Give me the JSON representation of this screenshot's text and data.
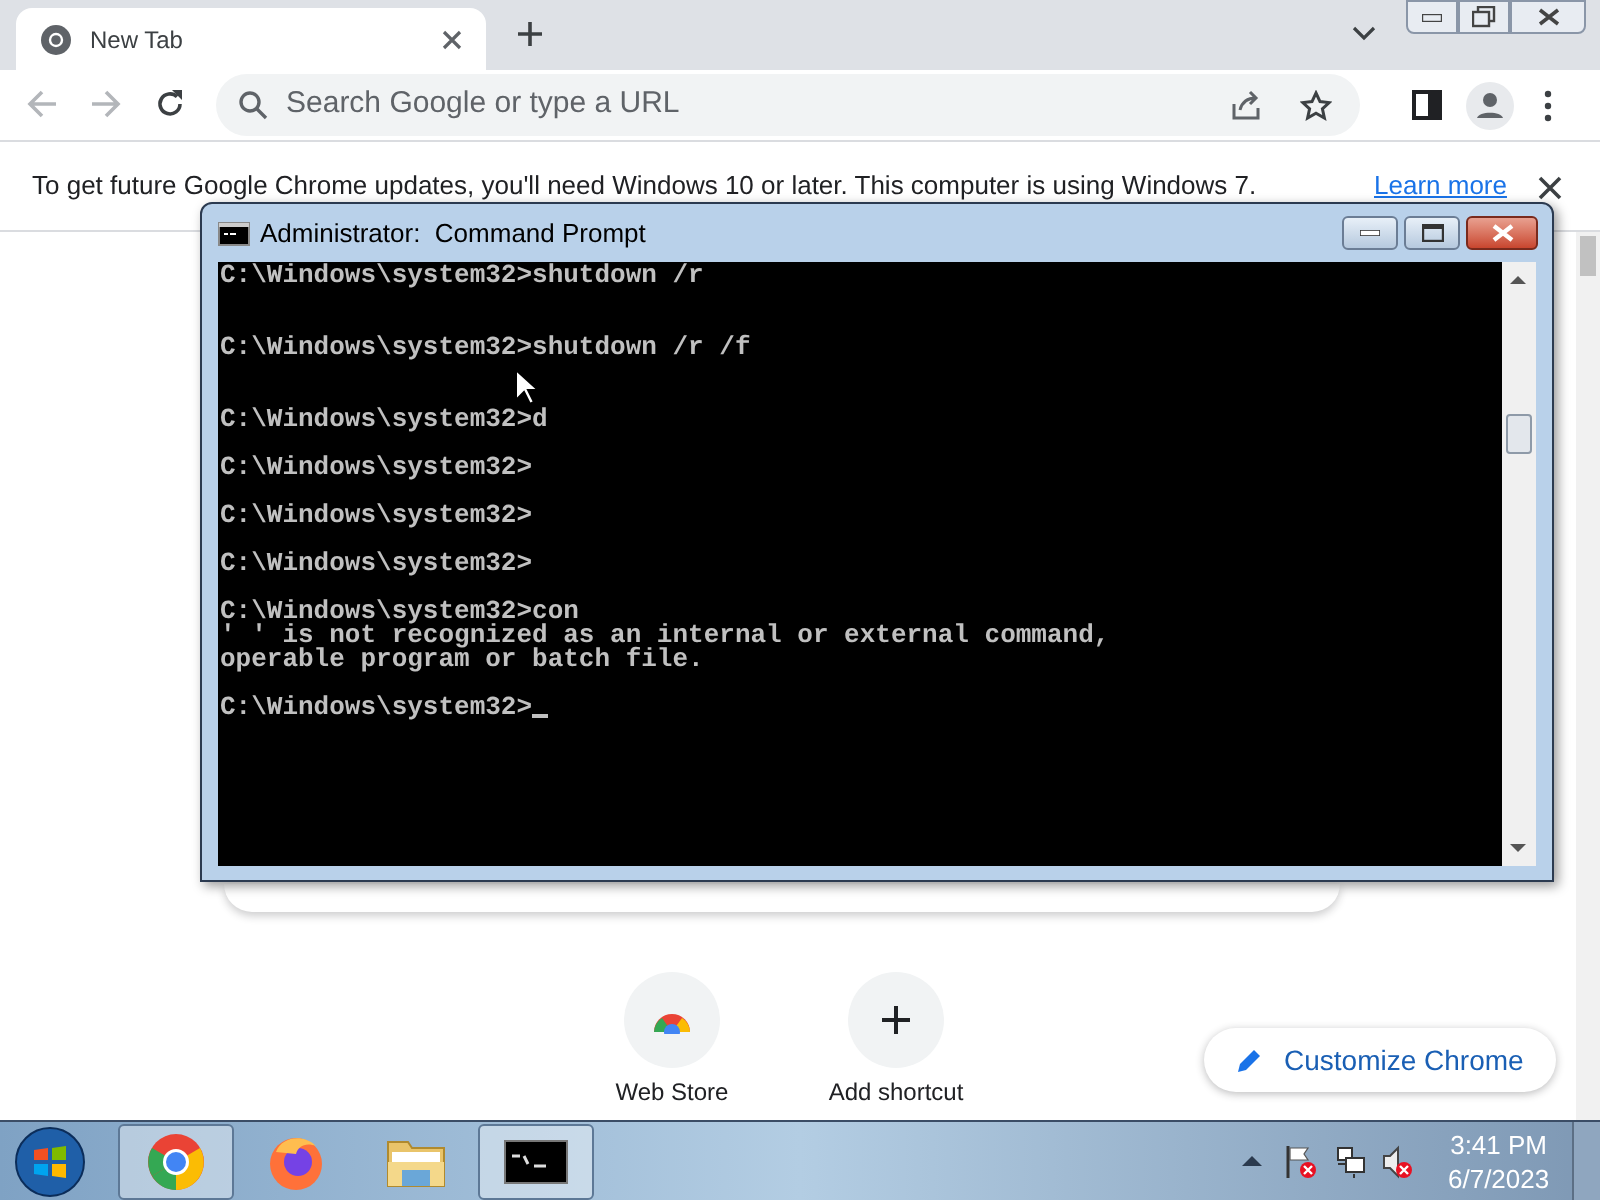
{
  "browser": {
    "tabs": [
      {
        "title": "New Tab",
        "selected": true
      }
    ],
    "omnibox": {
      "placeholder": "Search Google or type a URL"
    },
    "infobar": {
      "message": "To get future Google Chrome updates, you'll need Windows 10 or later. This computer is using Windows 7.",
      "link": "Learn more"
    },
    "shortcuts": [
      {
        "kind": "webstore",
        "label": "Web Store"
      },
      {
        "kind": "add",
        "label": "Add shortcut"
      }
    ],
    "customize_button": "Customize Chrome"
  },
  "console": {
    "title": "Administrator:  Command Prompt",
    "lines": [
      {
        "kind": "text",
        "text": "C:\\Windows\\system32>shutdown /r"
      },
      {
        "kind": "blank"
      },
      {
        "kind": "blank"
      },
      {
        "kind": "text",
        "text": "C:\\Windows\\system32>shutdown /r /f"
      },
      {
        "kind": "blank"
      },
      {
        "kind": "blank"
      },
      {
        "kind": "text",
        "text": "C:\\Windows\\system32>d"
      },
      {
        "kind": "blank"
      },
      {
        "kind": "text",
        "text": "C:\\Windows\\system32>"
      },
      {
        "kind": "blank"
      },
      {
        "kind": "text",
        "text": "C:\\Windows\\system32>"
      },
      {
        "kind": "blank"
      },
      {
        "kind": "text",
        "text": "C:\\Windows\\system32>"
      },
      {
        "kind": "blank"
      },
      {
        "kind": "text",
        "text": "C:\\Windows\\system32>con"
      },
      {
        "kind": "text",
        "text": "' ' is not recognized as an internal or external command,"
      },
      {
        "kind": "text",
        "text": "operable program or batch file."
      },
      {
        "kind": "blank"
      },
      {
        "kind": "prompt",
        "text": "C:\\Windows\\system32>"
      }
    ]
  },
  "taskbar": {
    "apps": [
      {
        "kind": "chrome",
        "running": true
      },
      {
        "kind": "firefox",
        "running": false
      },
      {
        "kind": "explorer",
        "running": false
      },
      {
        "kind": "cmd",
        "running": true
      }
    ],
    "clock": {
      "time": "3:41 PM",
      "date": "6/7/2023"
    }
  }
}
